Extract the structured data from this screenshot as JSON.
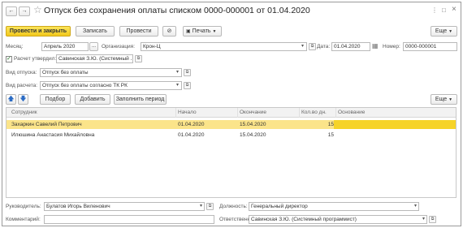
{
  "window": {
    "title": "Отпуск без сохранения оплаты списком 0000-000001 от 01.04.2020",
    "menu_glyph": "⋮",
    "minimize_glyph": "□",
    "close_glyph": "×"
  },
  "nav": {
    "back": "←",
    "forward": "→",
    "star": "☆"
  },
  "toolbar": {
    "post_close": "Провести и закрыть",
    "save": "Записать",
    "post": "Провести",
    "clip": "⊘",
    "print": "Печать",
    "more": "Еще"
  },
  "header": {
    "month_label": "Месяц:",
    "month_value": "Апрель 2020",
    "month_dots": "...",
    "org_label": "Организация:",
    "org_value": "Крон-Ц",
    "date_label": "Дата:",
    "date_value": "01.04.2020",
    "number_label": "Номер:",
    "number_value": "0000-000001",
    "approved_label": "Расчет утвердил:",
    "approved_checked": true,
    "approved_value": "Савинская З.Ю. (Системный ...",
    "leave_type_label": "Вид отпуска:",
    "leave_type_value": "Отпуск без оплаты",
    "calc_type_label": "Вид расчета:",
    "calc_type_value": "Отпуск без оплаты согласно ТК РК"
  },
  "table_toolbar": {
    "select": "Подбор",
    "add": "Добавить",
    "fill_period": "Заполнить период",
    "more": "Еще"
  },
  "table": {
    "columns": [
      "Сотрудник",
      "Начало",
      "Окончание",
      "Кол.во дн.",
      "Основание"
    ],
    "rows": [
      {
        "employee": "Захаркин Савелий Петрович",
        "start": "01.04.2020",
        "end": "15.04.2020",
        "days": "15",
        "basis": "",
        "selected": true
      },
      {
        "employee": "Илюшина Анастасия Михайловна",
        "start": "01.04.2020",
        "end": "15.04.2020",
        "days": "15",
        "basis": "",
        "selected": false
      }
    ]
  },
  "footer": {
    "head_label": "Руководитель:",
    "head_value": "Булатов Игорь Виленович",
    "position_label": "Должность:",
    "position_value": "Генеральный директор",
    "comment_label": "Комментарий:",
    "comment_value": "",
    "responsible_label": "Ответственный:",
    "responsible_value": "Савинская З.Ю. (Системный программист)"
  },
  "colors": {
    "accent_yellow": "#f6d328",
    "selected_row": "#fbe48a",
    "header_bg": "#f2f2f2"
  }
}
